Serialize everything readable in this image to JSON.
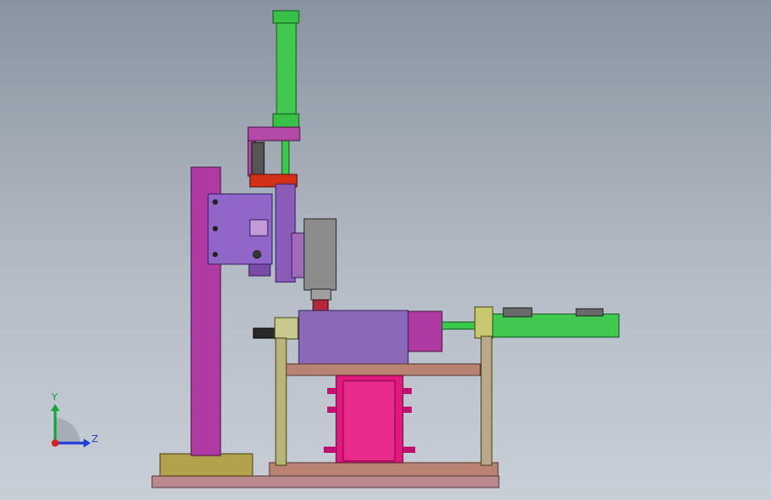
{
  "triad": {
    "y_label": "Y",
    "z_label": "Z",
    "y_color": "#1aa23a",
    "z_color": "#1f3fd6",
    "x_color": "#d62020"
  },
  "colors": {
    "magenta": "#b23aa6",
    "purple": "#8a5bbf",
    "green": "#3cc84a",
    "red": "#d03018",
    "olive": "#b8a85a",
    "tan": "#a87c6a",
    "pink": "#e0187a",
    "gray": "#8c8c8c",
    "khaki": "#b9b57a"
  }
}
